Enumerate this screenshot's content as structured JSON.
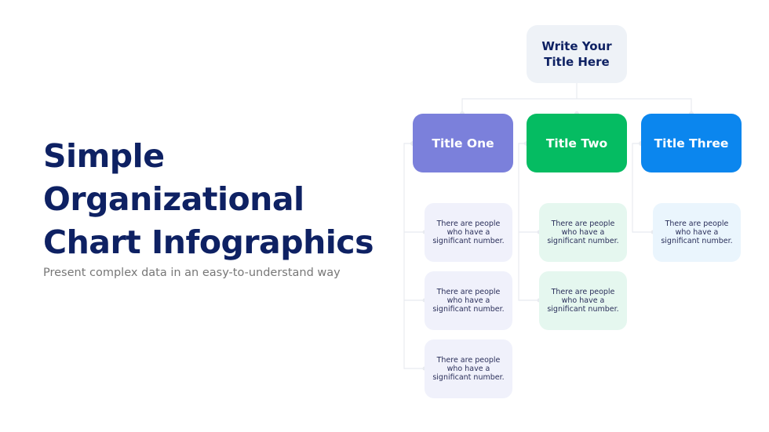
{
  "hero": {
    "title_lines": [
      "Simple",
      "Organizational",
      "Chart Infographics"
    ],
    "subtitle": "Present complex data in an easy-to-understand way"
  },
  "org_chart": {
    "root": {
      "title": "Write Your Title Here",
      "color": "#eef2f7"
    },
    "branches": [
      {
        "title": "Title One",
        "color": "#7b80db",
        "card_color": "#f0f1fb",
        "items": [
          "There are people who have a significant number.",
          "There are people who have a significant number.",
          "There are people who have a significant number."
        ]
      },
      {
        "title": "Title Two",
        "color": "#05bc62",
        "card_color": "#e5f7ef",
        "items": [
          "There are people who have a significant number.",
          "There are people who have a significant number."
        ]
      },
      {
        "title": "Title Three",
        "color": "#0b86ee",
        "card_color": "#eaf5fd",
        "items": [
          "There are people who have a significant number."
        ]
      }
    ],
    "connector_color": "#e8ebf0"
  }
}
